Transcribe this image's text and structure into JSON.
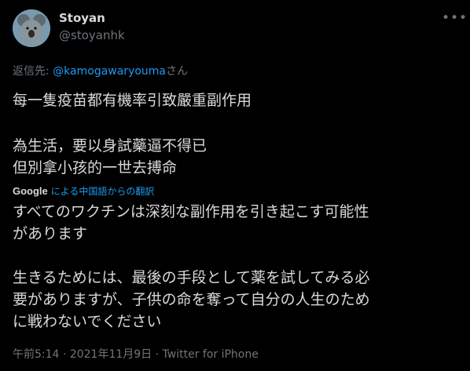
{
  "user": {
    "name": "Stoyan",
    "handle": "@stoyanhk"
  },
  "reply": {
    "prefix": "返信先: ",
    "mention": "@kamogawaryouma",
    "suffix": "さん"
  },
  "tweet": {
    "original_lines": [
      "每一隻疫苗都有機率引致嚴重副作用",
      "為生活，要以身試藥逼不得已",
      "但別拿小孩的一世去搏命"
    ]
  },
  "translation": {
    "brand": "Google",
    "label": "による中国語からの翻訳",
    "lines": [
      "すべてのワクチンは深刻な副作用を引き起こす可能性",
      "があります",
      "生きるためには、最後の手段として薬を試してみる必",
      "要がありますが、子供の命を奪って自分の人生のため",
      "に戦わないでください"
    ]
  },
  "meta": {
    "time": "午前5:14",
    "separator": " · ",
    "date": "2021年11月9日",
    "source": "Twitter for iPhone"
  },
  "icons": {
    "avatar": "koala-avatar",
    "more": "more-dots-icon"
  }
}
